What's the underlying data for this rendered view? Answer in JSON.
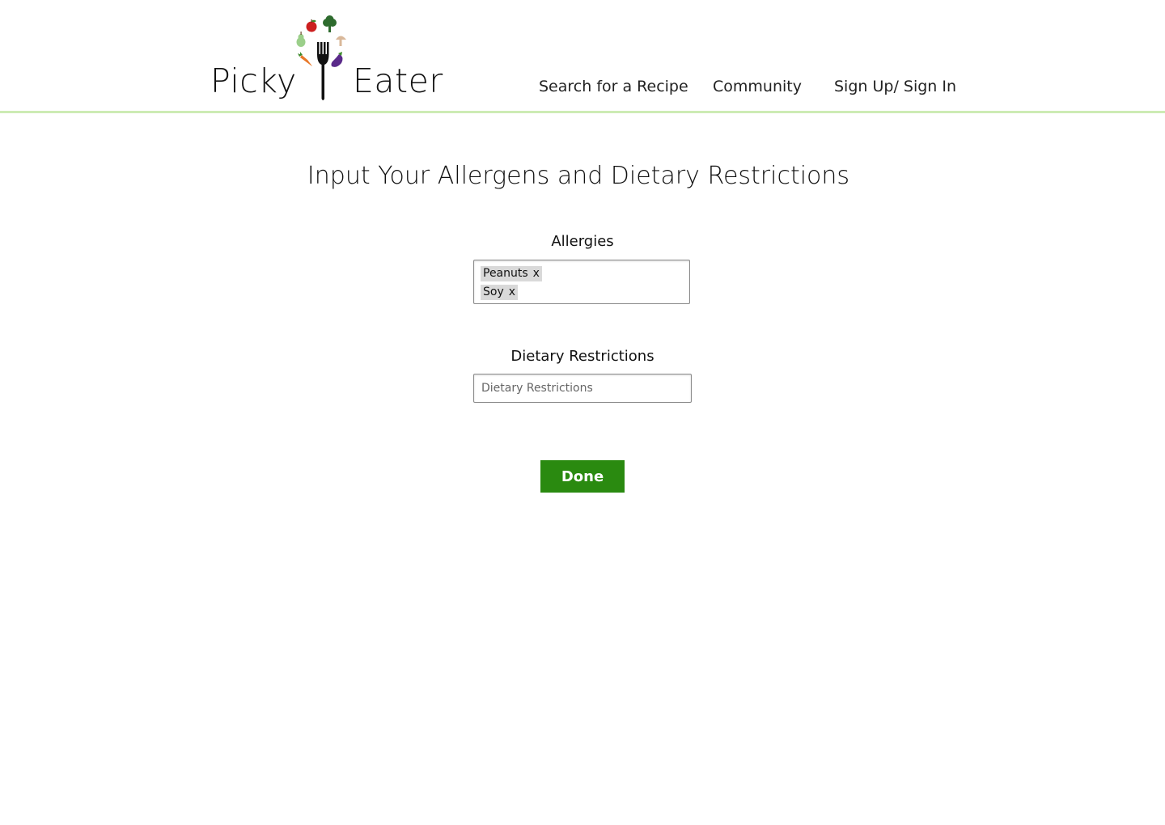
{
  "brand": {
    "word_left": "Picky",
    "word_right": "Eater"
  },
  "nav": {
    "search": "Search for a Recipe",
    "community": "Community",
    "signin": "Sign Up/ Sign In"
  },
  "main": {
    "title": "Input Your Allergens and Dietary Restrictions",
    "allergies": {
      "label": "Allergies",
      "tags": [
        {
          "label": "Peanuts",
          "remove": "x"
        },
        {
          "label": "Soy",
          "remove": "x"
        }
      ]
    },
    "dietary": {
      "label": "Dietary Restrictions",
      "value": "",
      "placeholder": "Dietary Restrictions"
    },
    "done_label": "Done"
  },
  "colors": {
    "accent_green": "#2a8a10",
    "header_rule": "#cdebb4",
    "tag_background": "#d9d9d9"
  },
  "icons": [
    "fork-icon",
    "apple-icon",
    "broccoli-icon",
    "pear-icon",
    "mushroom-icon",
    "carrot-icon",
    "eggplant-icon"
  ]
}
